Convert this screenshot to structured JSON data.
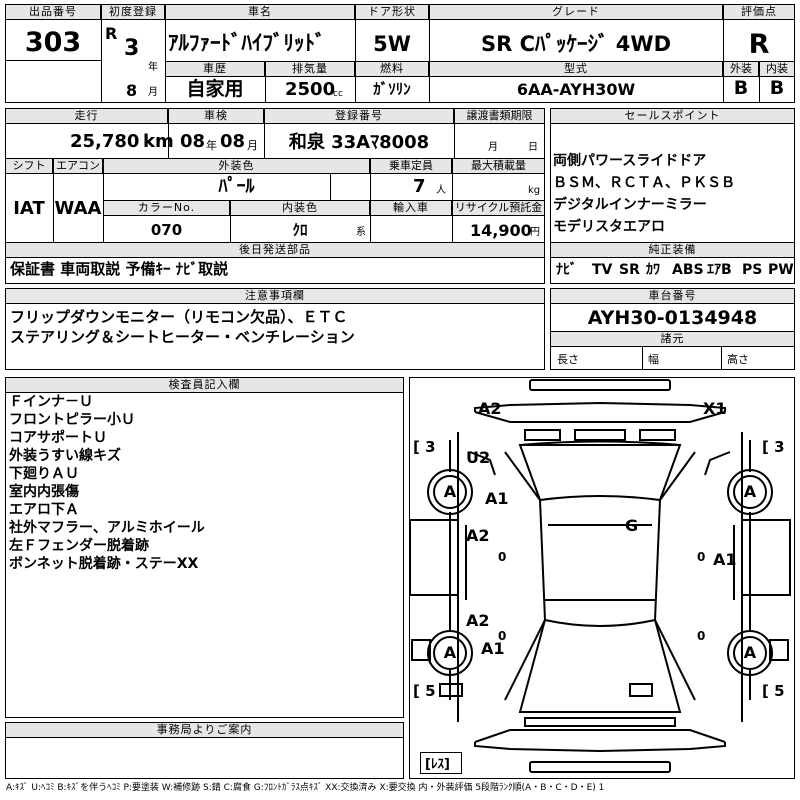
{
  "header": {
    "lot_label": "出品番号",
    "lot_value": "303",
    "first_reg_label": "初度登録",
    "era": "R",
    "first_reg_year": "3",
    "year_unit": "年",
    "first_reg_month": "8",
    "month_unit": "月",
    "car_name_label": "車名",
    "car_name": "ｱﾙﾌｧｰﾄﾞﾊｲﾌﾞﾘｯﾄﾞ",
    "door_label": "ドア形状",
    "door_value": "5W",
    "grade_label": "グレード",
    "grade_value": "SR Cﾊﾟｯｹｰｼﾞ 4WD",
    "score_label": "評価点",
    "score_value": "R",
    "history_label": "車歴",
    "history_value": "自家用",
    "displacement_label": "排気量",
    "displacement_value": "2500",
    "displacement_unit": "cc",
    "fuel_label": "燃料",
    "fuel_value": "ｶﾞｿﾘﾝ",
    "model_label": "型式",
    "model_value": "6AA-AYH30W",
    "exterior_label": "外装",
    "exterior_value": "B",
    "interior_label": "内装",
    "interior_value": "B"
  },
  "details": {
    "mileage_label": "走行",
    "mileage_value": "25,780",
    "mileage_unit": "km",
    "inspection_label": "車検",
    "insp_year": "08",
    "insp_year_unit": "年",
    "insp_month": "08",
    "insp_month_unit": "月",
    "plate_label": "登録番号",
    "plate_value": "和泉 33Aﾏ8008",
    "transfer_label": "譲渡書類期限",
    "transfer_month_unit": "月",
    "transfer_day_unit": "日",
    "shift_label": "シフト",
    "shift_value": "IAT",
    "ac_label": "エアコン",
    "ac_value": "WAA",
    "color_label": "外装色",
    "color_value": "ﾊﾟｰﾙ",
    "capacity_label": "乗車定員",
    "capacity_value": "7",
    "capacity_unit": "人",
    "load_label": "最大積載量",
    "load_unit": "kg",
    "color_no_label": "カラーNo.",
    "color_no_value": "070",
    "interior_color_label": "内装色",
    "interior_color_value": "ｸﾛ",
    "interior_color_unit": "系",
    "import_label": "輸入車",
    "recycle_label": "リサイクル預託金",
    "recycle_value": "14,900",
    "recycle_unit": "円",
    "later_parts_label": "後日発送部品",
    "later_parts_value": "保証書 車両取説 予備ｷｰ ﾅﾋﾞ取説"
  },
  "sales": {
    "label": "セールスポイント",
    "lines": [
      "両側パワースライドドア",
      "ＢＳＭ、ＲＣＴＡ、ＰＫＳＢ",
      "デジタルインナーミラー",
      "モデリスタエアロ"
    ],
    "equipment_label": "純正装備",
    "equipment": [
      "ﾅﾋﾞ",
      "TV",
      "SR",
      "ｶﾜ",
      "ABS",
      "ｴｱB",
      "PS",
      "PW"
    ]
  },
  "notes": {
    "label": "注意事項欄",
    "lines": [
      "フリップダウンモニター（リモコン欠品）、ＥＴＣ",
      "ステアリング＆シートヒーター・ベンチレーション"
    ]
  },
  "chassis": {
    "label": "車台番号",
    "value": "AYH30-0134948",
    "dims_label": "諸元",
    "length_label": "長さ",
    "width_label": "幅",
    "height_label": "高さ"
  },
  "inspector": {
    "label": "検査員記入欄",
    "lines": [
      "Ｆインナ－Ｕ",
      "フロントピラー小Ｕ",
      "コアサポートＵ",
      "外装うすい線キズ",
      "下廻りＡＵ",
      "室内内張傷",
      "エアロ下Ａ",
      "社外マフラー、アルミホイール",
      "左Ｆフェンダー脱着跡",
      "ボンネット脱着跡・ステーXX"
    ]
  },
  "office": {
    "label": "事務局よりご案内"
  },
  "diagram": {
    "marks": [
      "A2",
      "X1",
      "U2",
      "A1",
      "G",
      "A2",
      "0",
      "A1",
      "0",
      "A2",
      "A1",
      "A",
      "A",
      "A",
      "A",
      "0",
      "0"
    ],
    "bracket_tl": "[ 3",
    "bracket_tr": "[ 3",
    "bracket_bl": "[ 5",
    "bracket_br": "[ 5",
    "bracket_spare": "[ﾚｽ]"
  },
  "legend": "A:ｷｽﾞ U:ﾍｺﾐ B:ｷｽﾞを伴うﾍｺﾐ P:要塗装 W:補修跡 S:錆 C:腐食 G:ﾌﾛﾝﾄｶﾞﾗｽ点ｷｽﾞ XX:交換済み X:要交換 内・外装評価 5段階ﾗﾝｸ順(A・B・C・D・E) 1"
}
